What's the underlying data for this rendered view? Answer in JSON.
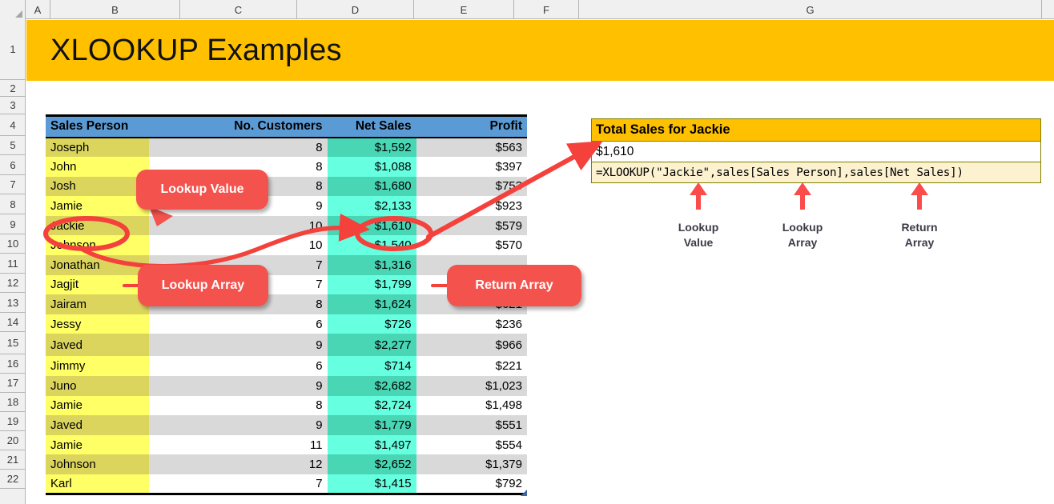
{
  "spreadsheet": {
    "column_headers": [
      "A",
      "B",
      "C",
      "D",
      "E",
      "F",
      "G"
    ],
    "row_headers": [
      "1",
      "2",
      "3",
      "4",
      "5",
      "6",
      "7",
      "8",
      "9",
      "10",
      "11",
      "12",
      "13",
      "14",
      "15",
      "16",
      "17",
      "18",
      "19",
      "20",
      "21",
      "22"
    ],
    "title": "XLOOKUP Examples",
    "title_bg": "#ffc000"
  },
  "table": {
    "headers": {
      "name": "Sales Person",
      "customers": "No. Customers",
      "net_sales": "Net Sales",
      "profit": "Profit"
    },
    "header_bg": "#5b9bd5",
    "rows": [
      {
        "name": "Joseph",
        "customers": "8",
        "net_sales": "$1,592",
        "profit": "$563"
      },
      {
        "name": "John",
        "customers": "8",
        "net_sales": "$1,088",
        "profit": "$397"
      },
      {
        "name": "Josh",
        "customers": "8",
        "net_sales": "$1,680",
        "profit": "$753"
      },
      {
        "name": "Jamie",
        "customers": "9",
        "net_sales": "$2,133",
        "profit": "$923"
      },
      {
        "name": "Jackie",
        "customers": "10",
        "net_sales": "$1,610",
        "profit": "$579"
      },
      {
        "name": "Johnson",
        "customers": "10",
        "net_sales": "$1,540",
        "profit": "$570"
      },
      {
        "name": "Jonathan",
        "customers": "7",
        "net_sales": "$1,316",
        "profit": ""
      },
      {
        "name": "Jagjit",
        "customers": "7",
        "net_sales": "$1,799",
        "profit": ""
      },
      {
        "name": "Jairam",
        "customers": "8",
        "net_sales": "$1,624",
        "profit": "$621"
      },
      {
        "name": "Jessy",
        "customers": "6",
        "net_sales": "$726",
        "profit": "$236"
      },
      {
        "name": "Javed",
        "customers": "9",
        "net_sales": "$2,277",
        "profit": "$966"
      },
      {
        "name": "Jimmy",
        "customers": "6",
        "net_sales": "$714",
        "profit": "$221"
      },
      {
        "name": "Juno",
        "customers": "9",
        "net_sales": "$2,682",
        "profit": "$1,023"
      },
      {
        "name": "Jamie",
        "customers": "8",
        "net_sales": "$2,724",
        "profit": "$1,498"
      },
      {
        "name": "Javed",
        "customers": "9",
        "net_sales": "$1,779",
        "profit": "$551"
      },
      {
        "name": "Jamie",
        "customers": "11",
        "net_sales": "$1,497",
        "profit": "$554"
      },
      {
        "name": "Johnson",
        "customers": "12",
        "net_sales": "$2,652",
        "profit": "$1,379"
      },
      {
        "name": "Karl",
        "customers": "7",
        "net_sales": "$1,415",
        "profit": "$792"
      }
    ]
  },
  "panel": {
    "title": "Total Sales for Jackie",
    "result": "$1,610",
    "formula": "=XLOOKUP(\"Jackie\",sales[Sales Person],sales[Net Sales])"
  },
  "formula_annotations": [
    {
      "line1": "Lookup",
      "line2": "Value"
    },
    {
      "line1": "Lookup",
      "line2": "Array"
    },
    {
      "line1": "Return",
      "line2": "Array"
    }
  ],
  "callouts": {
    "lookup_value": "Lookup Value",
    "lookup_array": "Lookup Array",
    "return_array": "Return Array",
    "color": "#f4524d"
  }
}
